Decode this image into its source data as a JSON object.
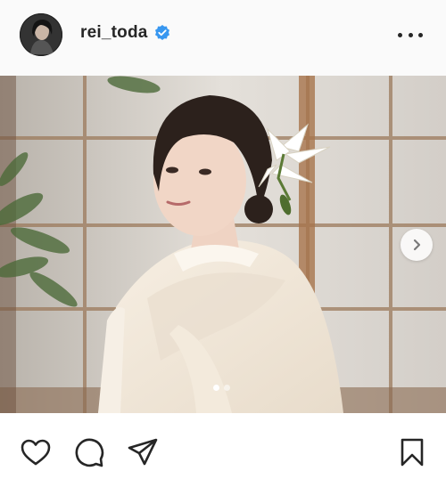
{
  "header": {
    "username": "rei_toda",
    "verified": true,
    "avatar_icon": "profile-photo",
    "more_icon": "more-options-icon"
  },
  "carousel": {
    "slides_total": 2,
    "active_index": 0,
    "next_icon": "chevron-right-icon"
  },
  "actions": {
    "like_icon": "heart-icon",
    "comment_icon": "comment-icon",
    "share_icon": "send-icon",
    "save_icon": "bookmark-icon"
  },
  "colors": {
    "text": "#262626",
    "verified_badge": "#3897f0",
    "background": "#fafafa"
  }
}
